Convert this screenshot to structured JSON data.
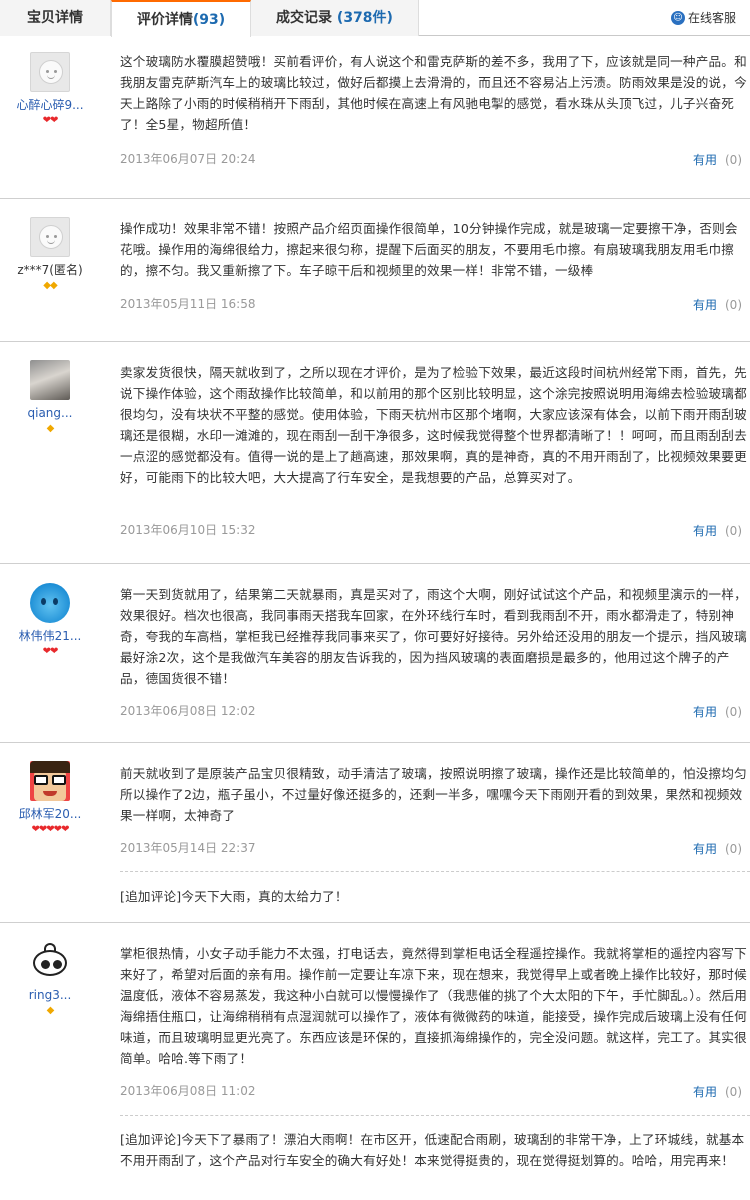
{
  "tabs": {
    "baobei": "宝贝详情",
    "review_label": "评价详情",
    "review_count": "93",
    "trade_label": "成交记录",
    "trade_count": "378件",
    "service": "在线客服"
  },
  "reviews": [
    {
      "user": "心醉心碎9...",
      "rank": "❤❤",
      "avatar": "default-avatar",
      "content": "这个玻璃防水覆膜超赞哦！买前看评价，有人说这个和雷克萨斯的差不多，我用了下，应该就是同一种产品。和我朋友雷克萨斯汽车上的玻璃比较过，做好后都摸上去滑滑的，而且还不容易沾上污渍。防雨效果是没的说，今天上路除了小雨的时候稍稍开下雨刮，其他时候在高速上有风驰电掣的感觉，看水珠从头顶飞过，儿子兴奋死了！全5星，物超所值！",
      "date": "2013年06月07日 20:24",
      "useful": "有用",
      "useful_count": "(0)"
    },
    {
      "user": "z***7(匿名)",
      "rank": "◆◆",
      "avatar": "default-avatar",
      "content": "操作成功！效果非常不错！按照产品介绍页面操作很简单，10分钟操作完成，就是玻璃一定要擦干净，否则会花哦。操作用的海绵很给力，擦起来很匀称，提醒下后面买的朋友，不要用毛巾擦。有扇玻璃我朋友用毛巾擦的，擦不匀。我又重新擦了下。车子晾干后和视频里的效果一样！非常不错，一级棒",
      "date": "2013年05月11日 16:58",
      "useful": "有用",
      "useful_count": "(0)"
    },
    {
      "user": "qiang...",
      "rank": "◆",
      "avatar": "photo-avatar",
      "content": "卖家发货很快，隔天就收到了，之所以现在才评价，是为了检验下效果，最近这段时间杭州经常下雨，首先，先说下操作体验，这个雨敌操作比较简单，和以前用的那个区别比较明显，这个涂完按照说明用海绵去检验玻璃都很均匀，没有块状不平整的感觉。使用体验，下雨天杭州市区那个堵啊，大家应该深有体会，以前下雨开雨刮玻璃还是很糊，水印一滩滩的，现在雨刮一刮干净很多，这时候我觉得整个世界都清晰了！！呵呵，而且雨刮刮去一点涩的感觉都没有。值得一说的是上了趟高速，那效果啊，真的是神奇，真的不用开雨刮了，比视频效果要更好，可能雨下的比较大吧，大大提高了行车安全，是我想要的产品，总算买对了。",
      "date": "2013年06月10日 15:32",
      "useful": "有用",
      "useful_count": "(0)"
    },
    {
      "user": "林伟伟21...",
      "rank": "❤❤",
      "avatar": "drop-avatar",
      "content": "第一天到货就用了，结果第二天就暴雨，真是买对了，雨这个大啊，刚好试试这个产品，和视频里演示的一样，效果很好。档次也很高，我同事雨天搭我车回家，在外环线行车时，看到我雨刮不开，雨水都滑走了，特别神奇，夸我的车高档，掌柜我已经推荐我同事来买了，你可要好好接待。另外给还没用的朋友一个提示，挡风玻璃最好涂2次，这个是我做汽车美容的朋友告诉我的，因为挡风玻璃的表面磨损是最多的，他用过这个牌子的产品，德国货很不错！",
      "date": "2013年06月08日 12:02",
      "useful": "有用",
      "useful_count": "(0)"
    },
    {
      "user": "邱林军20...",
      "rank": "❤❤❤❤❤",
      "avatar": "glasses-avatar",
      "content": "前天就收到了是原装产品宝贝很精致，动手清洁了玻璃，按照说明擦了玻璃，操作还是比较简单的，怕没擦均匀所以操作了2边，瓶子虽小，不过量好像还挺多的，还剩一半多，嘿嘿今天下雨刚开看的到效果，果然和视频效果一样啊，太神奇了",
      "date": "2013年05月14日 22:37",
      "useful": "有用",
      "useful_count": "(0)",
      "append": "[追加评论]今天下大雨，真的太给力了！"
    },
    {
      "user": "ring3...",
      "rank": "◆",
      "avatar": "cartoon-avatar",
      "content": "掌柜很热情，小女子动手能力不太强，打电话去，竟然得到掌柜电话全程遥控操作。我就将掌柜的遥控内容写下来好了，希望对后面的亲有用。操作前一定要让车凉下来，现在想来，我觉得早上或者晚上操作比较好，那时候温度低，液体不容易蒸发，我这种小白就可以慢慢操作了（我悲催的挑了个大太阳的下午，手忙脚乱。）。然后用海绵捂住瓶口，让海绵稍稍有点湿润就可以操作了，液体有微微药的味道，能接受，操作完成后玻璃上没有任何味道，而且玻璃明显更光亮了。东西应该是环保的，直接抓海绵操作的，完全没问题。就这样，完工了。其实很简单。哈哈.等下雨了！",
      "date": "2013年06月08日 11:02",
      "useful": "有用",
      "useful_count": "(0)",
      "append": "[追加评论]今天下了暴雨了！漂泊大雨啊！在市区开，低速配合雨刷，玻璃刮的非常干净，上了环城线，就基本不用开雨刮了，这个产品对行车安全的确大有好处！本来觉得挺贵的，现在觉得挺划算的。哈哈，用完再来！"
    }
  ]
}
